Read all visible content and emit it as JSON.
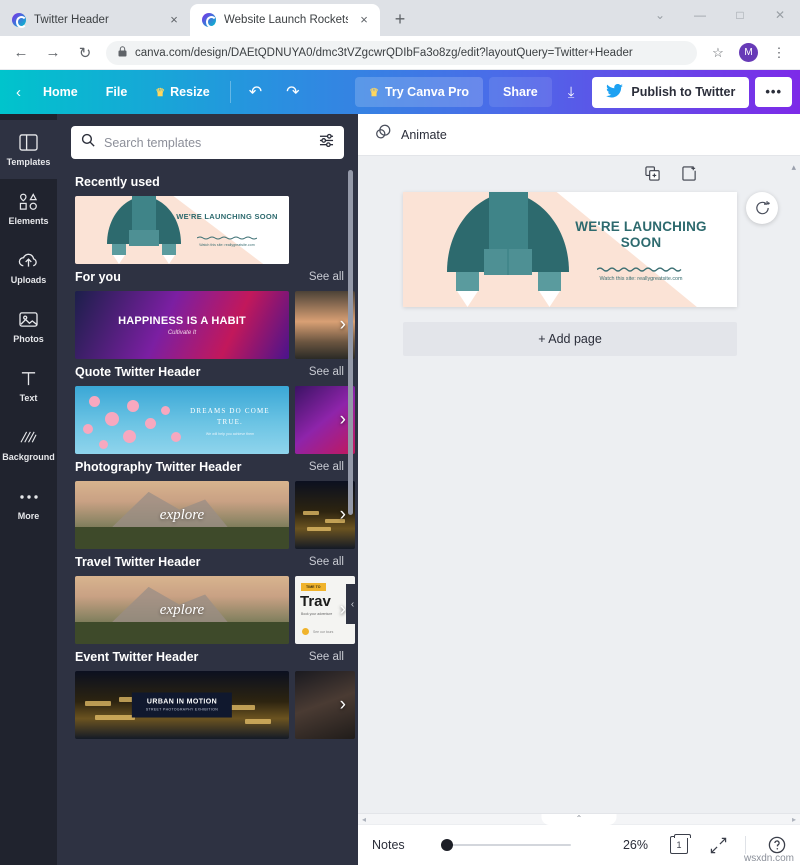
{
  "browser": {
    "tabs": [
      {
        "title": "Twitter Header",
        "close": "×",
        "active": false
      },
      {
        "title": "Website Launch Rocketship Twitt",
        "close": "×",
        "active": true
      }
    ],
    "new_tab_label": "+",
    "window_controls": {
      "collapse": "⌄",
      "minimize": "—",
      "maximize": "□",
      "close": "✕"
    },
    "nav": {
      "back": "←",
      "forward": "→",
      "reload": "↻"
    },
    "omnibox": {
      "lock": "🔒",
      "url": "canva.com/design/DAEtQDNUYA0/dmc3tVZgcwrQDIbFa3o8zg/edit?layoutQuery=Twitter+Header",
      "star": "☆"
    },
    "profile_initial": "M",
    "menu": "⋮"
  },
  "canva_topbar": {
    "back": "‹",
    "home": "Home",
    "file": "File",
    "resize": "Resize",
    "resize_crown": "♛",
    "undo": "↶",
    "redo": "↷",
    "try_pro": "Try Canva Pro",
    "try_pro_crown": "♛",
    "share": "Share",
    "download": "⤓",
    "publish": "Publish to Twitter",
    "more": "•••"
  },
  "rail": {
    "items": [
      {
        "label": "Templates",
        "icon": "templates-icon",
        "active": true
      },
      {
        "label": "Elements",
        "icon": "elements-icon",
        "active": false
      },
      {
        "label": "Uploads",
        "icon": "uploads-icon",
        "active": false
      },
      {
        "label": "Photos",
        "icon": "photos-icon",
        "active": false
      },
      {
        "label": "Text",
        "icon": "text-icon",
        "active": false
      },
      {
        "label": "Background",
        "icon": "background-icon",
        "active": false
      },
      {
        "label": "More",
        "icon": "more-icon",
        "active": false
      }
    ]
  },
  "panel": {
    "search": {
      "placeholder": "Search templates",
      "icon": "search-icon",
      "filter_icon": "filter-icon"
    },
    "collapse_arrow": "‹",
    "sections": [
      {
        "title": "Recently used",
        "see_all": ""
      },
      {
        "title": "For you",
        "see_all": "See all"
      },
      {
        "title": "Quote Twitter Header",
        "see_all": "See all"
      },
      {
        "title": "Photography Twitter Header",
        "see_all": "See all"
      },
      {
        "title": "Travel Twitter Header",
        "see_all": "See all"
      },
      {
        "title": "Event Twitter Header",
        "see_all": "See all"
      }
    ],
    "thumbs": {
      "rocket_title": "WE'RE LAUNCHING SOON",
      "rocket_sub": "Watch this site: reallygreatsite.com",
      "happiness": "HAPPINESS IS A HABIT",
      "happiness_sub": "Cultivate It",
      "dreams": "DREAMS DO COME TRUE.",
      "dreams_sub": "We will help you achieve them",
      "explore": "explore",
      "urban": "URBAN IN MOTION",
      "urban_sub": "STREET PHOTOGRAPHY EXHIBITION",
      "travel_tag": "TIME TO",
      "travel_big": "Trav",
      "travel_sm": "Book your adventure",
      "travel_sm2": "See our tours"
    },
    "next_arrow": "›"
  },
  "canvas": {
    "animate": "Animate",
    "animate_icon": "animate-icon",
    "duplicate_icon": "duplicate-page-icon",
    "addpage_icon": "add-page-icon",
    "refresh_icon": "refresh-design-icon",
    "scroll_up": "▴",
    "design": {
      "title": "WE'RE LAUNCHING SOON",
      "subtitle": "Watch this site: reallygreatsite.com",
      "bg_color": "#fbe3d6",
      "accent_color": "#2d6a6e"
    },
    "add_page": "+ Add page"
  },
  "bottombar": {
    "notes": "Notes",
    "zoom": "26%",
    "page_count": "1",
    "expand_icon": "expand-icon",
    "help_icon": "help-icon",
    "scroll_left": "◂",
    "scroll_right": "▸",
    "panel_toggle": "⌃",
    "watermark": "wsxdn.com"
  },
  "colors": {
    "canva_gradient_start": "#00c4cc",
    "canva_gradient_end": "#7d2ae8",
    "panel_bg": "#2e3242",
    "rail_bg": "#20232e",
    "twitter_blue": "#1da1f2"
  }
}
